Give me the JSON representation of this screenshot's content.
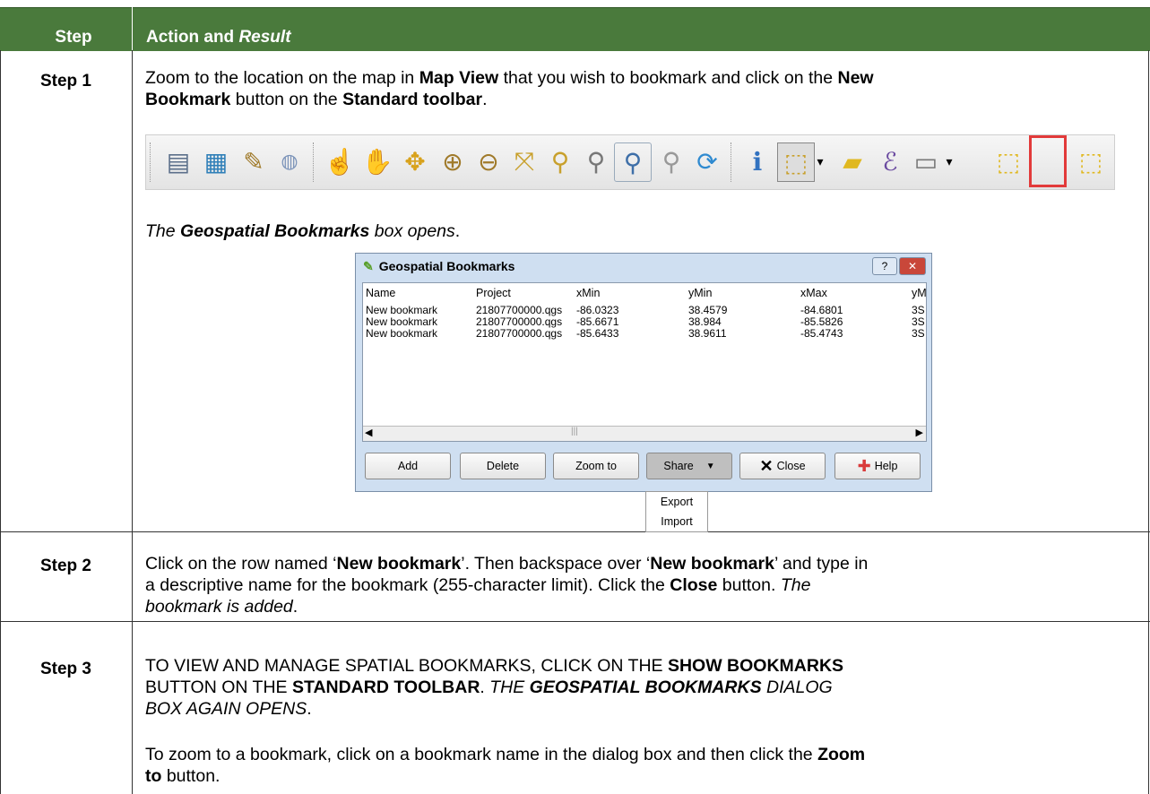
{
  "header": {
    "col1": "Step",
    "col2_action": "Action and ",
    "col2_result": "Result"
  },
  "step1": {
    "label": "Step 1",
    "line1_a": "Zoom to the location on the map in ",
    "line1_b": "Map View",
    "line1_c": " that you wish to bookmark and click on the ",
    "line1_d": "New",
    "line2_a": "Bookmark",
    "line2_b": " button on the ",
    "line2_c": "Standard toolbar",
    "line2_d": ".",
    "result_a": "The ",
    "result_b": "Geospatial Bookmarks",
    "result_c": " box opens",
    "result_d": "."
  },
  "toolbar_icons": [
    "save-icon",
    "map-icon",
    "brush-icon",
    "globe-icon",
    "touch-icon",
    "pan-hand-icon",
    "pan-to-selection-icon",
    "zoom-in-icon",
    "zoom-out-icon",
    "zoom-full-icon",
    "zoom-to-selection-icon",
    "zoom-to-layer-icon",
    "zoom-last-icon",
    "zoom-next-icon",
    "refresh-icon",
    "identify-icon",
    "select-icon",
    "deselect-icon",
    "expression-select-icon",
    "measure-icon",
    "new-bookmark-icon",
    "show-bookmarks-icon"
  ],
  "dialog": {
    "title": "Geospatial Bookmarks",
    "help_ctrl": "?",
    "close_ctrl": "✕",
    "columns": [
      "Name",
      "Project",
      "xMin",
      "yMin",
      "xMax",
      "yM"
    ],
    "rows": [
      [
        "New bookmark",
        "21807700000.qgs",
        "-86.0323",
        "38.4579",
        "-84.6801",
        "3S"
      ],
      [
        "New bookmark",
        "21807700000.qgs",
        "-85.6671",
        "38.984",
        "-85.5826",
        "3S"
      ],
      [
        "New bookmark",
        "21807700000.qgs",
        "-85.6433",
        "38.9611",
        "-85.4743",
        "3S"
      ]
    ],
    "buttons": {
      "add": "Add",
      "delete": "Delete",
      "zoom_to": "Zoom to",
      "share": "Share",
      "close": "Close",
      "help": "Help"
    },
    "share_menu": [
      "Export",
      "Import"
    ]
  },
  "step2": {
    "label": "Step 2",
    "l1_a": "Click on the row named ‘",
    "l1_b": "New bookmark",
    "l1_c": "’. Then backspace over ‘",
    "l1_d": "New bookmark",
    "l1_e": "’ and type in",
    "l2": "a descriptive name for the bookmark (255-character limit). Click the ",
    "l2_b": "Close",
    "l2_c": " button. ",
    "l2_d": "The",
    "l3": "bookmark is added",
    "l3_b": "."
  },
  "step3": {
    "label": "Step 3",
    "l1_a": "TO VIEW AND MANAGE SPATIAL BOOKMARKS, CLICK ON THE ",
    "l1_b": "SHOW BOOKMARKS",
    "l2_a": "BUTTON ON THE ",
    "l2_b": "STANDARD TOOLBAR",
    "l2_c": ". ",
    "l2_d": "THE ",
    "l2_e": "GEOSPATIAL BOOKMARKS",
    "l2_f": " DIALOG",
    "l3": "BOX AGAIN OPENS",
    "l3_b": ".",
    "p2_a": "To zoom to a bookmark, click on a bookmark name in the dialog box and then click the ",
    "p2_b": "Zoom",
    "p2_c": "to",
    "p2_d": " button."
  }
}
